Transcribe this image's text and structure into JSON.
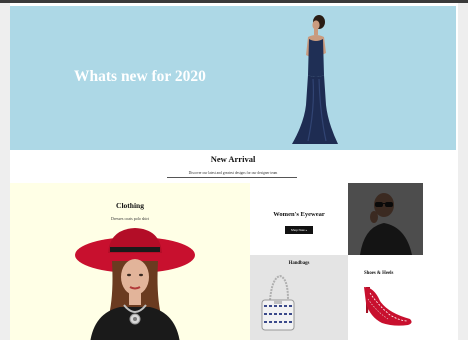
{
  "hero": {
    "title": "Whats new for 2020",
    "background": "#add8e6"
  },
  "new_arrival": {
    "title": "New Arrival",
    "subtitle": "Discover our latest and greatest designs for our designer team"
  },
  "clothing": {
    "title": "Clothing",
    "subtitle": "Dresses coats polo shirt",
    "background": "#ffffe6"
  },
  "eyewear": {
    "title": "Women's Eyewear",
    "button_label": "Shop Now »"
  },
  "handbags": {
    "title": "Handbags"
  },
  "shoes": {
    "title": "Shoes & Heels"
  }
}
